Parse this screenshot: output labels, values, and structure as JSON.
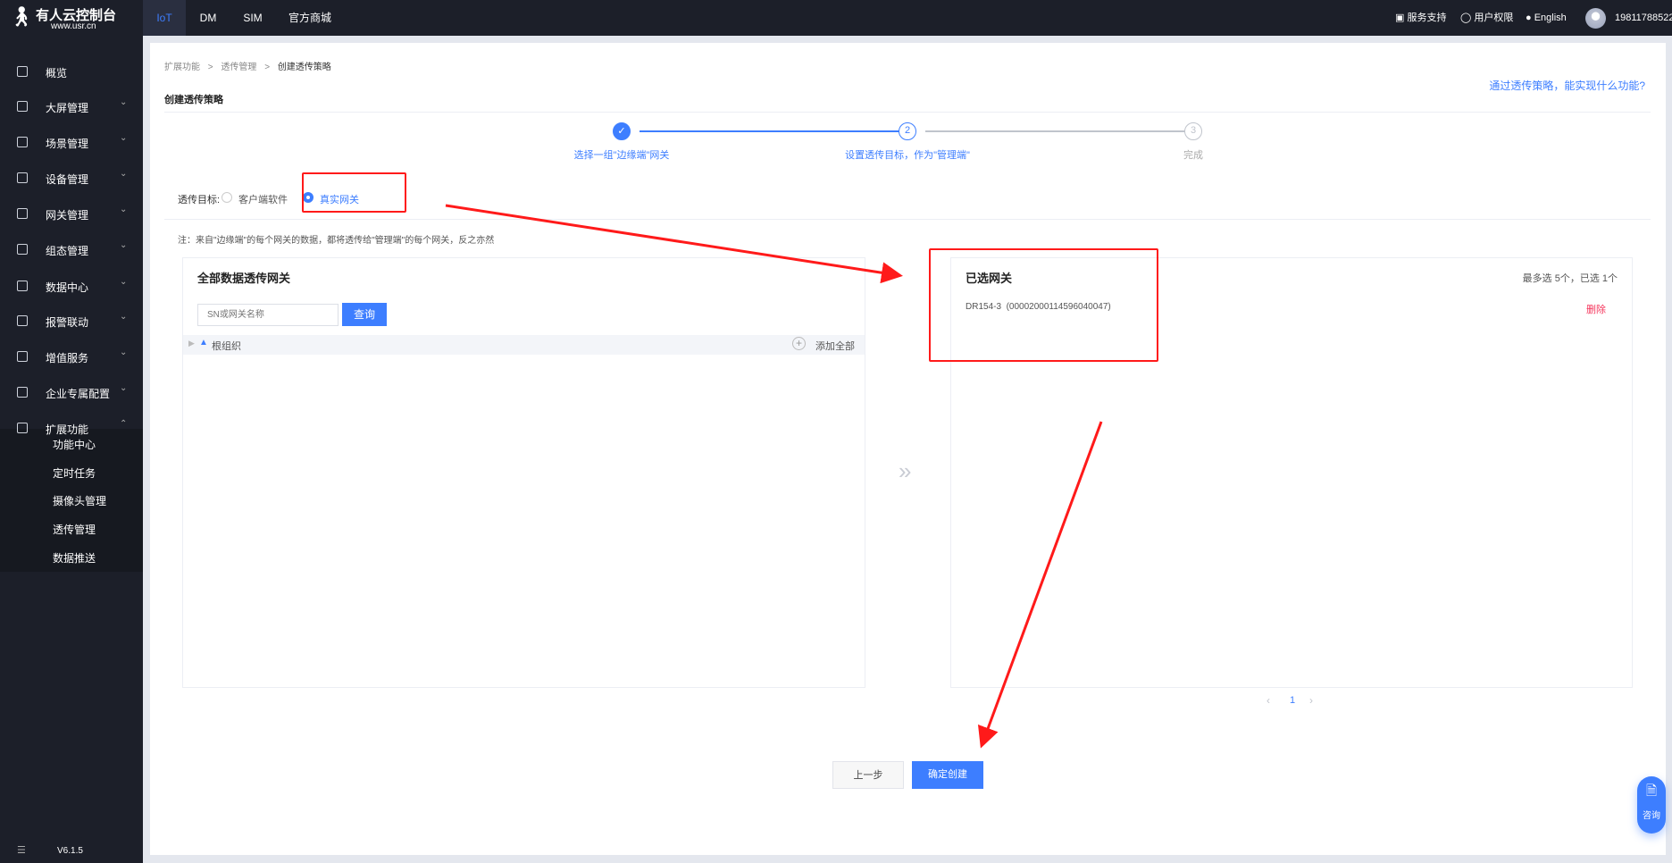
{
  "brand": {
    "name": "有人云控制台",
    "url": "www.usr.cn"
  },
  "topnav": {
    "tabs": [
      "IoT",
      "DM",
      "SIM",
      "官方商城"
    ],
    "service": "服务支持",
    "permissions": "用户权限",
    "language": "English",
    "user": "19811788522"
  },
  "sidebar": {
    "items": [
      "概览",
      "大屏管理",
      "场景管理",
      "设备管理",
      "网关管理",
      "组态管理",
      "数据中心",
      "报警联动",
      "增值服务",
      "企业专属配置",
      "扩展功能"
    ],
    "submenu": [
      "功能中心",
      "定时任务",
      "摄像头管理",
      "透传管理",
      "数据推送"
    ],
    "version": "V6.1.5"
  },
  "breadcrumb": [
    "扩展功能",
    "透传管理",
    "创建透传策略"
  ],
  "page_title": "创建透传策略",
  "help_link": "通过透传策略，能实现什么功能?",
  "steps": [
    {
      "num": "1",
      "label": "选择一组\"边缘端\"网关",
      "state": "done"
    },
    {
      "num": "2",
      "label": "设置透传目标，作为\"管理端\"",
      "state": "active"
    },
    {
      "num": "3",
      "label": "完成",
      "state": "pending"
    }
  ],
  "target": {
    "label": "透传目标:",
    "options": [
      "客户端软件",
      "真实网关"
    ],
    "selected": "真实网关"
  },
  "note": "注：来自\"边缘端\"的每个网关的数据，都将透传给\"管理端\"的每个网关，反之亦然",
  "left_panel": {
    "title": "全部数据透传网关",
    "search_placeholder": "SN或网关名称",
    "search_button": "查询",
    "tree_root": "根组织",
    "add_all": "添加全部"
  },
  "right_panel": {
    "title": "已选网关",
    "limit": "最多选 5个，已选 1个",
    "items": [
      {
        "name": "DR154-3",
        "sn": "(00002000114596040047)",
        "action": "删除"
      }
    ]
  },
  "pagination": {
    "current": "1"
  },
  "buttons": {
    "prev": "上一步",
    "confirm": "确定创建"
  },
  "consult": "咨询",
  "colors": {
    "accent": "#3d7eff",
    "sidebar": "#1c1f29",
    "danger": "#f5365c",
    "annotation": "#ff1a1a"
  }
}
